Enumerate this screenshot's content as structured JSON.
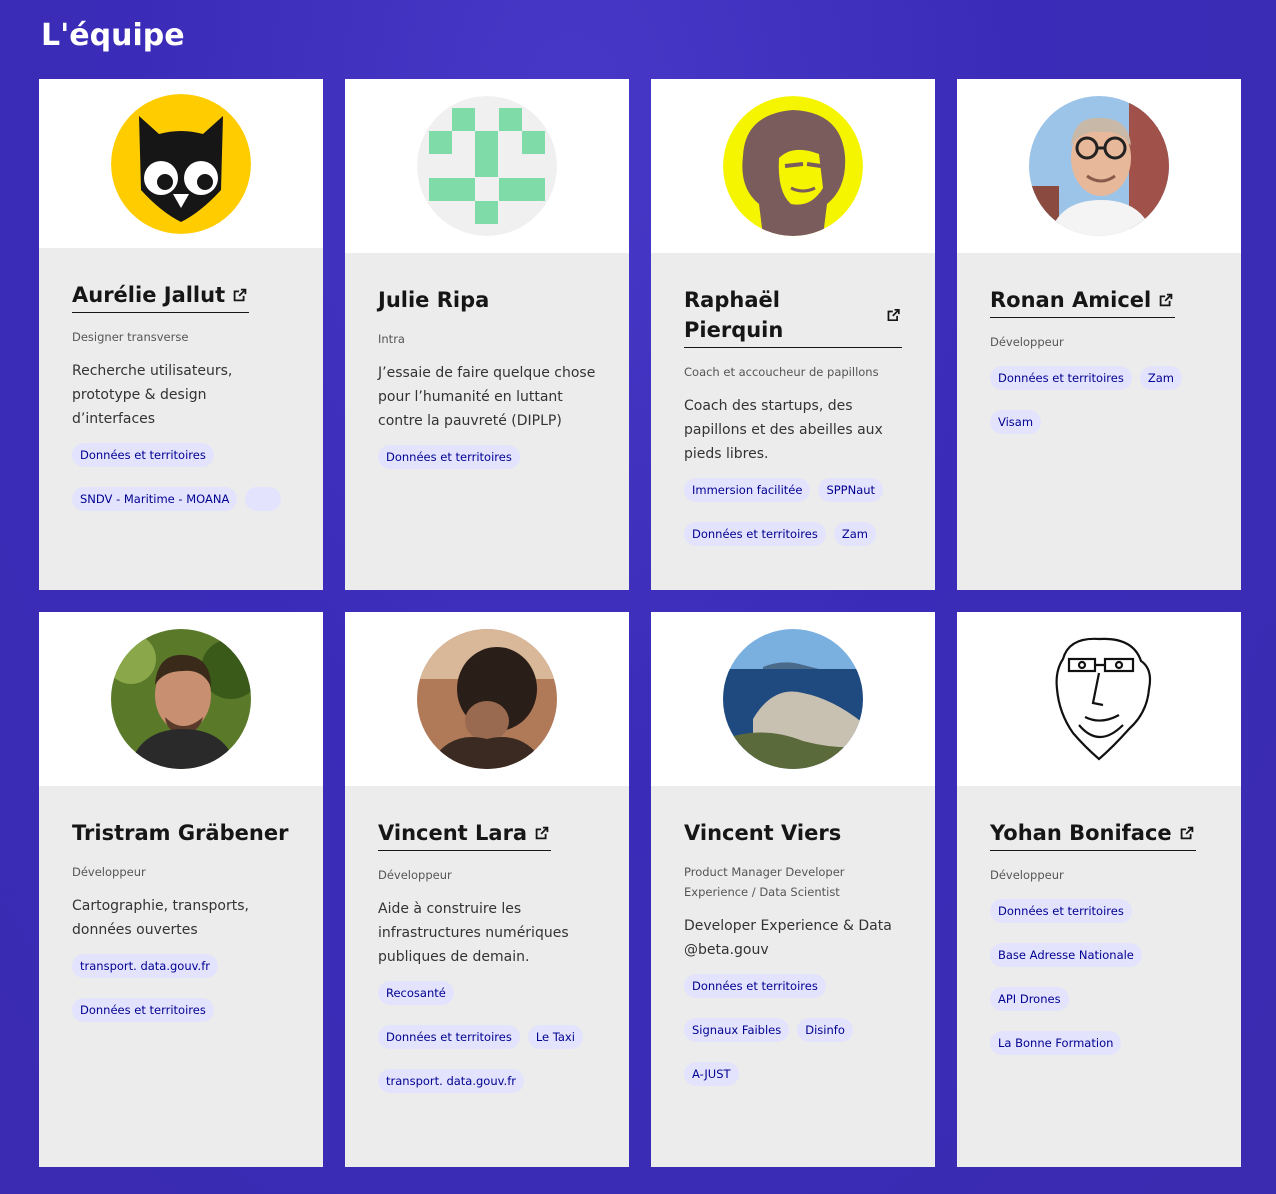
{
  "page": {
    "title": "L'équipe"
  },
  "members": [
    {
      "name": "Aurélie Jallut",
      "link": true,
      "role": "Designer transverse",
      "description": "Recherche utilisateurs, prototype & design d’interfaces",
      "tags": [
        "Données et territoires",
        "SNDV - Maritime - MOANA",
        ""
      ],
      "avatar": "owl-icon"
    },
    {
      "name": "Julie Ripa",
      "link": false,
      "role": "Intra",
      "description": "J’essaie de faire quelque chose pour l’humanité en luttant contre la pauvreté (DIPLP)",
      "tags": [
        "Données et territoires"
      ],
      "avatar": "identicon"
    },
    {
      "name": "Raphaël Pierquin",
      "link": true,
      "role": "Coach et accoucheur de papillons",
      "description": "Coach des startups, des papillons et des abeilles aux pieds libres.",
      "tags": [
        "Immersion facilitée",
        "SPPNaut",
        "Données et territoires",
        "Zam"
      ],
      "avatar": "portrait-yellow"
    },
    {
      "name": "Ronan Amicel",
      "link": true,
      "role": "Développeur",
      "description": "",
      "tags": [
        "Données et territoires",
        "Zam",
        "Visam"
      ],
      "avatar": "portrait-photo"
    },
    {
      "name": "Tristram Gräbener",
      "link": false,
      "role": "Développeur",
      "description": "Cartographie, transports, données ouvertes",
      "tags": [
        "transport. data.gouv.fr",
        "Données et territoires"
      ],
      "avatar": "portrait-photo"
    },
    {
      "name": "Vincent Lara",
      "link": true,
      "role": "Développeur",
      "description": "Aide à construire les infrastructures numériques publiques de demain.",
      "tags": [
        "Recosanté",
        "Données et territoires",
        "Le Taxi",
        "transport. data.gouv.fr"
      ],
      "avatar": "portrait-photo"
    },
    {
      "name": "Vincent Viers",
      "link": false,
      "role": "Product Manager Developer Experience / Data Scientist",
      "description": "Developer Experience & Data @beta.gouv",
      "tags": [
        "Données et territoires",
        "Signaux Faibles",
        "Disinfo",
        "A-JUST"
      ],
      "avatar": "landscape-photo"
    },
    {
      "name": "Yohan Boniface",
      "link": true,
      "role": "Développeur",
      "description": "",
      "tags": [
        "Données et territoires",
        "Base Adresse Nationale",
        "API Drones",
        "La Bonne Formation"
      ],
      "avatar": "sketch-portrait"
    }
  ],
  "colors": {
    "background": "#3a2cb8",
    "card": "#ececec",
    "tag_bg": "#e3e3fd",
    "tag_text": "#000091"
  }
}
